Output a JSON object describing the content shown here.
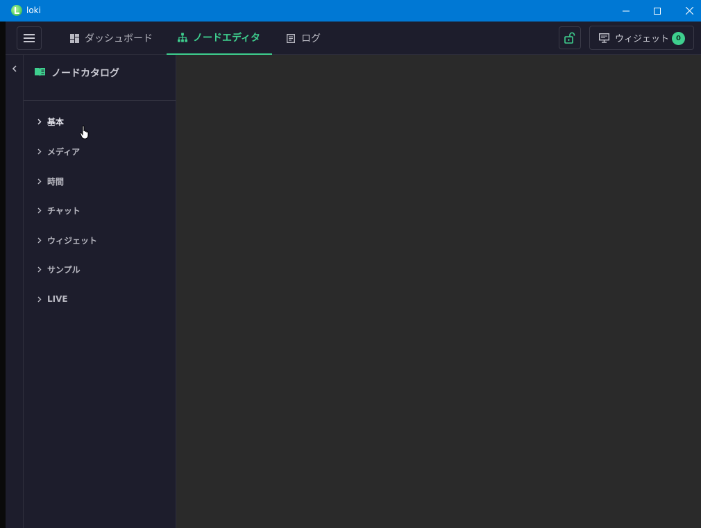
{
  "window": {
    "title": "loki"
  },
  "header": {
    "tabs": [
      {
        "label": "ダッシュボード",
        "icon": "dashboard-icon"
      },
      {
        "label": "ノードエディタ",
        "icon": "sitemap-icon",
        "active": true
      },
      {
        "label": "ログ",
        "icon": "log-icon"
      }
    ],
    "widget_button": {
      "label": "ウィジェット",
      "count": "0",
      "icon": "monitor-icon"
    }
  },
  "catalog": {
    "title": "ノードカタログ",
    "items": [
      {
        "label": "基本"
      },
      {
        "label": "メディア"
      },
      {
        "label": "時間"
      },
      {
        "label": "チャット"
      },
      {
        "label": "ウィジェット"
      },
      {
        "label": "サンプル"
      },
      {
        "label": "LIVE"
      }
    ]
  },
  "colors": {
    "accent": "#3ecf8e",
    "titlebar": "#0078d4",
    "panel_bg": "#1d1d2c",
    "canvas_bg": "#2a2a2a"
  }
}
